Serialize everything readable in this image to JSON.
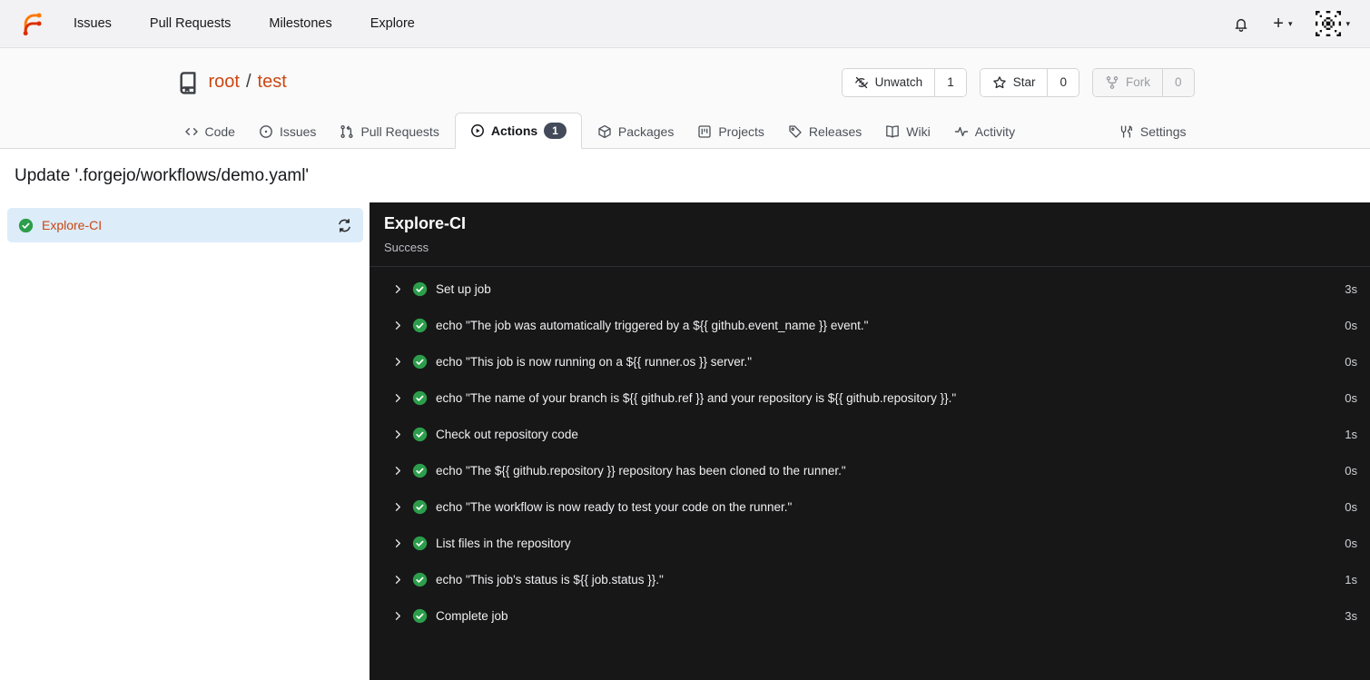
{
  "navbar": {
    "links": [
      {
        "label": "Issues"
      },
      {
        "label": "Pull Requests"
      },
      {
        "label": "Milestones"
      },
      {
        "label": "Explore"
      }
    ],
    "plus_label": "+"
  },
  "repo": {
    "owner": "root",
    "separator": "/",
    "name": "test",
    "actions": [
      {
        "label": "Unwatch",
        "count": "1"
      },
      {
        "label": "Star",
        "count": "0"
      },
      {
        "label": "Fork",
        "count": "0",
        "disabled": true
      }
    ]
  },
  "tabs": [
    {
      "label": "Code"
    },
    {
      "label": "Issues"
    },
    {
      "label": "Pull Requests"
    },
    {
      "label": "Actions",
      "badge": "1",
      "active": true
    },
    {
      "label": "Packages"
    },
    {
      "label": "Projects"
    },
    {
      "label": "Releases"
    },
    {
      "label": "Wiki"
    },
    {
      "label": "Activity"
    },
    {
      "label": "Settings"
    }
  ],
  "page": {
    "title": "Update '.forgejo/workflows/demo.yaml'"
  },
  "sidebar": {
    "jobs": [
      {
        "label": "Explore-CI",
        "status": "success"
      }
    ]
  },
  "run_panel": {
    "title": "Explore-CI",
    "status": "Success",
    "steps": [
      {
        "label": "Set up job",
        "duration": "3s"
      },
      {
        "label": "echo \"The job was automatically triggered by a ${{ github.event_name }} event.\"",
        "duration": "0s"
      },
      {
        "label": "echo \"This job is now running on a ${{ runner.os }} server.\"",
        "duration": "0s"
      },
      {
        "label": "echo \"The name of your branch is ${{ github.ref }} and your repository is ${{ github.repository }}.\"",
        "duration": "0s"
      },
      {
        "label": "Check out repository code",
        "duration": "1s"
      },
      {
        "label": "echo \"The ${{ github.repository }} repository has been cloned to the runner.\"",
        "duration": "0s"
      },
      {
        "label": "echo \"The workflow is now ready to test your code on the runner.\"",
        "duration": "0s"
      },
      {
        "label": "List files in the repository",
        "duration": "0s"
      },
      {
        "label": "echo \"This job's status is ${{ job.status }}.\"",
        "duration": "1s"
      },
      {
        "label": "Complete job",
        "duration": "3s"
      }
    ]
  },
  "colors": {
    "accent_link": "#cb4712",
    "success_green": "#2c9e4b",
    "panel_bg": "#171718",
    "selected_job_bg": "#dcecf9",
    "badge_bg": "#434b5a",
    "brand_orange": "#ff7800",
    "brand_red": "#dd2e00"
  }
}
